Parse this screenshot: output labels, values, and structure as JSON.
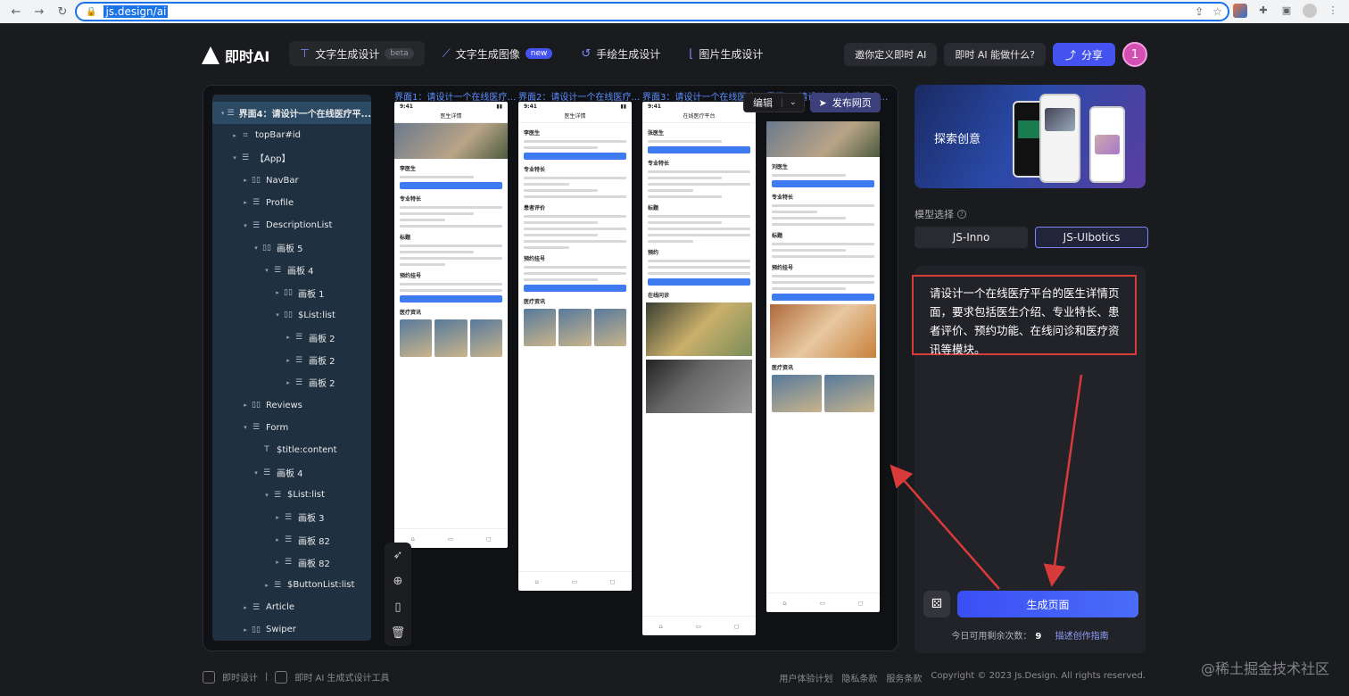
{
  "browser": {
    "url": "js.design/ai"
  },
  "header": {
    "logo_text": "即时AI",
    "tabs": [
      {
        "label": "文字生成设计",
        "badge": "beta"
      },
      {
        "label": "文字生成图像",
        "badge": "new"
      },
      {
        "label": "手绘生成设计",
        "badge": ""
      },
      {
        "label": "图片生成设计",
        "badge": ""
      }
    ],
    "invite_label": "邀你定义即时 AI",
    "what_label": "即时 AI 能做什么?",
    "share_label": "分享",
    "avatar_initial": "1"
  },
  "canvas": {
    "frame_labels": [
      "界面1：请设计一个在线医疗…",
      "界面2：请设计一个在线医疗…",
      "界面3：请设计一个在线医疗…",
      "界面4：请设计一个在线医疗…"
    ],
    "edit_label": "编辑",
    "publish_label": "发布网页"
  },
  "layers": [
    {
      "label": "界面4：请设计一个在线医疗平...",
      "depth": 0,
      "arrow": "▾",
      "icon": "☰",
      "selected": true
    },
    {
      "label": "topBar#id",
      "depth": 1,
      "arrow": "▸",
      "icon": "⌗"
    },
    {
      "label": "【App】",
      "depth": 1,
      "arrow": "▾",
      "icon": "☰"
    },
    {
      "label": "NavBar",
      "depth": 2,
      "arrow": "▸",
      "icon": "▯▯"
    },
    {
      "label": "Profile",
      "depth": 2,
      "arrow": "▸",
      "icon": "☰"
    },
    {
      "label": "DescriptionList",
      "depth": 2,
      "arrow": "▾",
      "icon": "☰"
    },
    {
      "label": "画板 5",
      "depth": 3,
      "arrow": "▾",
      "icon": "▯▯"
    },
    {
      "label": "画板 4",
      "depth": 4,
      "arrow": "▾",
      "icon": "☰"
    },
    {
      "label": "画板 1",
      "depth": 5,
      "arrow": "▸",
      "icon": "▯▯"
    },
    {
      "label": "$List:list",
      "depth": 5,
      "arrow": "▾",
      "icon": "▯▯"
    },
    {
      "label": "画板 2",
      "depth": 6,
      "arrow": "▸",
      "icon": "☰"
    },
    {
      "label": "画板 2",
      "depth": 6,
      "arrow": "▸",
      "icon": "☰"
    },
    {
      "label": "画板 2",
      "depth": 6,
      "arrow": "▸",
      "icon": "☰"
    },
    {
      "label": "Reviews",
      "depth": 2,
      "arrow": "▸",
      "icon": "▯▯"
    },
    {
      "label": "Form",
      "depth": 2,
      "arrow": "▾",
      "icon": "☰"
    },
    {
      "label": "$title:content",
      "depth": 3,
      "arrow": "",
      "icon": "T"
    },
    {
      "label": "画板 4",
      "depth": 3,
      "arrow": "▾",
      "icon": "☰"
    },
    {
      "label": "$List:list",
      "depth": 4,
      "arrow": "▾",
      "icon": "☰"
    },
    {
      "label": "画板 3",
      "depth": 5,
      "arrow": "▸",
      "icon": "☰"
    },
    {
      "label": "画板 82",
      "depth": 5,
      "arrow": "▸",
      "icon": "☰"
    },
    {
      "label": "画板 82",
      "depth": 5,
      "arrow": "▸",
      "icon": "☰"
    },
    {
      "label": "$ButtonList:list",
      "depth": 4,
      "arrow": "▸",
      "icon": "☰"
    },
    {
      "label": "Article",
      "depth": 2,
      "arrow": "▸",
      "icon": "☰"
    },
    {
      "label": "Swiper",
      "depth": 2,
      "arrow": "▸",
      "icon": "▯▯"
    }
  ],
  "phones": [
    {
      "time": "9:41",
      "title": "医生详情",
      "doctor": "李医生",
      "sections": [
        "专业特长",
        "标题",
        "预约挂号",
        "医疗资讯"
      ]
    },
    {
      "time": "9:41",
      "title": "医生详情",
      "doctor": "李医生",
      "sections": [
        "专业特长",
        "患者评价",
        "预约挂号",
        "医疗资讯"
      ]
    },
    {
      "time": "9:41",
      "title": "在线医疗平台",
      "doctor": "张医生",
      "sections": [
        "专业特长",
        "标题",
        "预约",
        "在线问诊"
      ]
    },
    {
      "time": "9:41",
      "title": "",
      "doctor": "刘医生",
      "sections": [
        "专业特长",
        "标题",
        "预约挂号",
        "医疗资讯"
      ]
    }
  ],
  "right_panel": {
    "explore_label": "探索创意",
    "model_label": "模型选择",
    "models": [
      {
        "label": "JS-Inno",
        "selected": false
      },
      {
        "label": "JS-UIbotics",
        "selected": true
      }
    ],
    "prompt": "请设计一个在线医疗平台的医生详情页面，要求包括医生介绍、专业特长、患者评价、预约功能、在线问诊和医疗资讯等模块。",
    "generate_label": "生成页面",
    "quota_label": "今日可用剩余次数：",
    "quota_value": "9",
    "guide_label": "描述创作指南"
  },
  "footer": {
    "left_items": [
      "即时设计",
      "即时 AI 生成式设计工具"
    ],
    "right_items": [
      "用户体验计划",
      "隐私条款",
      "服务条款",
      "Copyright © 2023 Js.Design. All rights reserved."
    ],
    "watermark": "@稀土掘金技术社区"
  },
  "colors": {
    "accent": "#4452f0",
    "annotation_red": "#d93a3a",
    "link_blue": "#5a8fff"
  }
}
